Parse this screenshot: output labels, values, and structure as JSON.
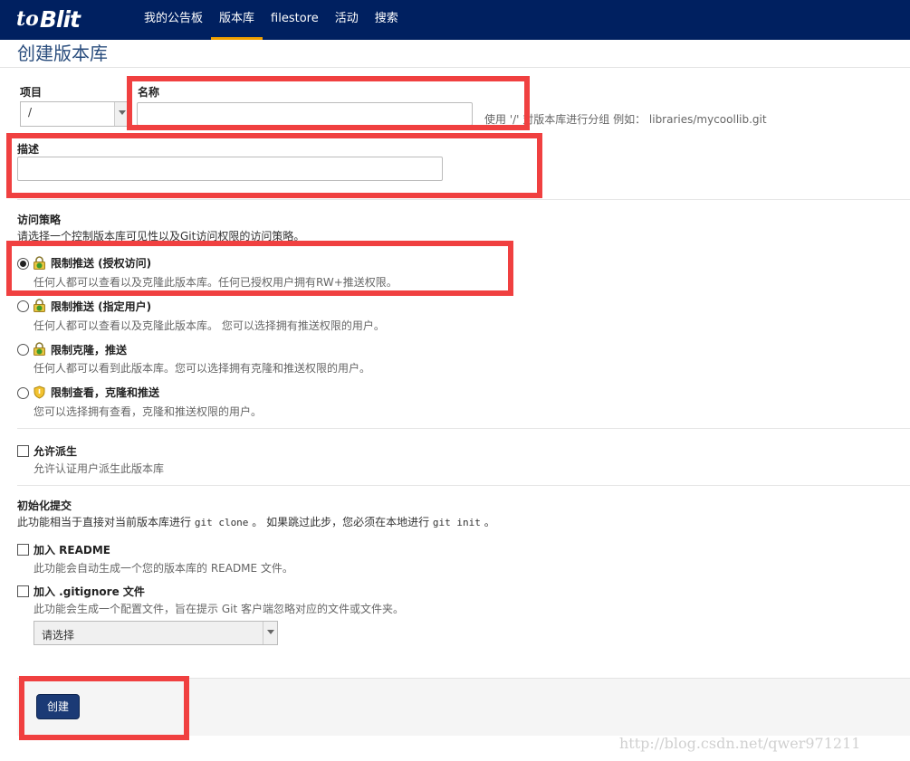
{
  "brand": {
    "mark": "to",
    "text": "Blit"
  },
  "nav": [
    {
      "label": "我的公告板"
    },
    {
      "label": "版本库"
    },
    {
      "label": "filestore"
    },
    {
      "label": "活动"
    },
    {
      "label": "搜索"
    }
  ],
  "page_title": "创建版本库",
  "form": {
    "project_label": "项目",
    "project_value": "/",
    "name_label": "名称",
    "name_value": "",
    "name_hint": "使用 '/' 对版本库进行分组 例如： libraries/mycoollib.git",
    "desc_label": "描述",
    "desc_value": ""
  },
  "access": {
    "title": "访问策略",
    "desc": "请选择一个控制版本库可见性以及Git访问权限的访问策略。",
    "options": [
      {
        "title": "限制推送 (授权访问)",
        "desc": "任何人都可以查看以及克隆此版本库。任何已授权用户拥有RW+推送权限。",
        "checked": true,
        "icon": "lock-green-icon"
      },
      {
        "title": "限制推送 (指定用户)",
        "desc": "任何人都可以查看以及克隆此版本库。 您可以选择拥有推送权限的用户。",
        "checked": false,
        "icon": "lock-green-icon"
      },
      {
        "title": "限制克隆，推送",
        "desc": "任何人都可以看到此版本库。您可以选择拥有克隆和推送权限的用户。",
        "checked": false,
        "icon": "lock-green-icon"
      },
      {
        "title": "限制查看，克隆和推送",
        "desc": "您可以选择拥有查看，克隆和推送权限的用户。",
        "checked": false,
        "icon": "shield-icon"
      }
    ]
  },
  "fork": {
    "title": "允许派生",
    "desc": "允许认证用户派生此版本库",
    "checked": false
  },
  "init": {
    "title": "初始化提交",
    "desc_pre": "此功能相当于直接对当前版本库进行 ",
    "desc_code1": "git clone",
    "desc_mid": " 。 如果跳过此步，您必须在本地进行 ",
    "desc_code2": "git init",
    "desc_post": " 。",
    "readme_title": "加入 README",
    "readme_desc": "此功能会自动生成一个您的版本库的 README 文件。",
    "readme_checked": false,
    "gitignore_title": "加入 .gitignore 文件",
    "gitignore_desc": "此功能会生成一个配置文件，旨在提示 Git 客户端忽略对应的文件或文件夹。",
    "gitignore_checked": false,
    "gitignore_select": "请选择"
  },
  "create_label": "创建",
  "watermark": "http://blog.csdn.net/qwer971211",
  "colors": {
    "navbar": "#002060",
    "accent": "#f0a000",
    "button": "#1b3a75",
    "annotation": "#f04040"
  }
}
